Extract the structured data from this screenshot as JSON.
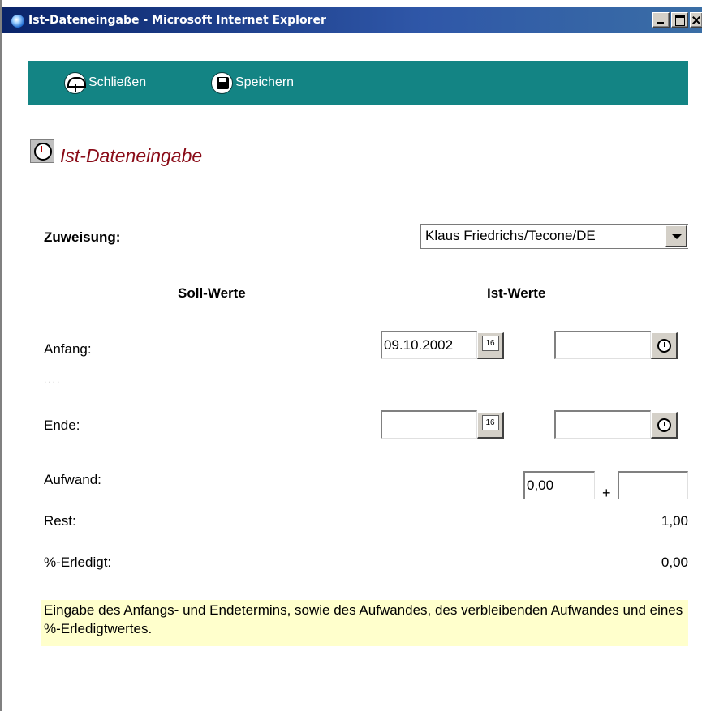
{
  "window": {
    "title": "Ist-Dateneingabe - Microsoft Internet Explorer",
    "app_icon": "internet-explorer-icon"
  },
  "toolbar": {
    "close_label": "Schließen",
    "close_icon": "umbrella-icon",
    "save_label": "Speichern",
    "save_icon": "floppy-disk-icon",
    "background": "#138484"
  },
  "page": {
    "title": "Ist-Dateneingabe",
    "title_icon": "clock-document-icon",
    "title_color": "#8a0c18"
  },
  "assignment": {
    "label": "Zuweisung:",
    "selected": "Klaus Friedrichs/Tecone/DE"
  },
  "columns": {
    "plan": "Soll-Werte",
    "actual": "Ist-Werte"
  },
  "start": {
    "label": "Anfang:",
    "date_value": "09.10.2002",
    "time_value": "",
    "calendar_text": "16"
  },
  "end": {
    "label": "Ende:",
    "date_value": "",
    "time_value": "",
    "calendar_text": "16"
  },
  "separator_dots": "....",
  "effort": {
    "label": "Aufwand:",
    "value": "0,00",
    "plus": "+",
    "additional": ""
  },
  "remaining": {
    "label": "Rest:",
    "value": "1,00"
  },
  "percent_done": {
    "label": "%-Erledigt:",
    "value": "0,00"
  },
  "help": {
    "text": "Eingabe des Anfangs- und Endetermins, sowie des Aufwandes, des verbleibenden Aufwandes und eines %-Erledigtwertes."
  }
}
